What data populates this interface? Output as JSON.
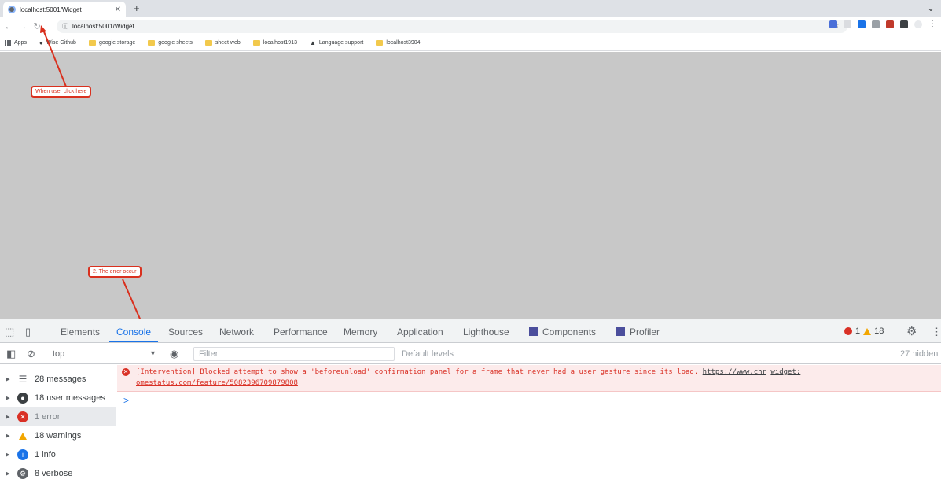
{
  "browser": {
    "tab_title": "localhost:5001/Widget",
    "url": "localhost:5001/Widget",
    "bookmarks": [
      {
        "label": "Apps",
        "icon": "apps-icon"
      },
      {
        "label": "Wise Github",
        "icon": "github-icon"
      },
      {
        "label": "google storage",
        "icon": "folder-icon"
      },
      {
        "label": "google sheets",
        "icon": "folder-icon"
      },
      {
        "label": "sheet web",
        "icon": "folder-icon"
      },
      {
        "label": "localhost1913",
        "icon": "folder-icon"
      },
      {
        "label": "Language support",
        "icon": "translate-icon"
      },
      {
        "label": "localhost3904",
        "icon": "folder-icon"
      }
    ]
  },
  "annotations": {
    "reload_note": "When user click here",
    "error_note": "2. The error occur"
  },
  "devtools": {
    "tabs": [
      "Elements",
      "Console",
      "Sources",
      "Network",
      "Performance",
      "Memory",
      "Application",
      "Lighthouse",
      "Components",
      "Profiler"
    ],
    "active_tab": "Console",
    "error_count": "1",
    "warning_count": "18",
    "context": "top",
    "filter_placeholder": "Filter",
    "levels": "Default levels",
    "hidden": "27 hidden",
    "sidebar": [
      {
        "label": "28 messages",
        "icon": "list-icon"
      },
      {
        "label": "18 user messages",
        "icon": "user-icon"
      },
      {
        "label": "1 error",
        "icon": "error-icon"
      },
      {
        "label": "18 warnings",
        "icon": "warning-icon"
      },
      {
        "label": "1 info",
        "icon": "info-icon"
      },
      {
        "label": "8 verbose",
        "icon": "verbose-icon"
      }
    ],
    "error_message": {
      "line1": "[Intervention] Blocked attempt to show a 'beforeunload' confirmation panel for a frame that never had a user gesture since its load.",
      "link1": "https://www.chr",
      "source": "widget:",
      "line2": "omestatus.com/feature/5082396709879808"
    },
    "prompt": ">"
  },
  "colors": {
    "accent": "#1a73e8",
    "error": "#d93025",
    "warning": "#f2a600",
    "page_bg": "#c8c8c8",
    "annotation": "#d9301e"
  }
}
